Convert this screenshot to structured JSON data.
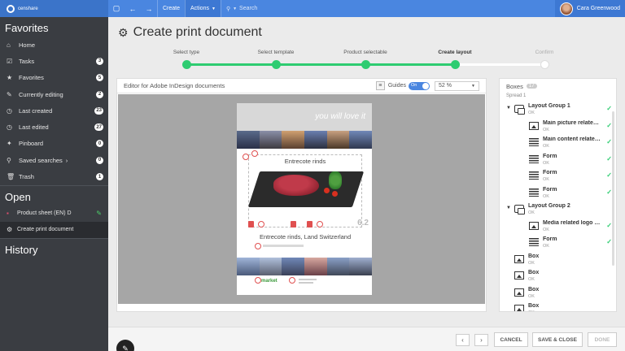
{
  "topbar": {
    "logo_text": "censhare",
    "create_label": "Create",
    "actions_label": "Actions",
    "search_placeholder": "Search",
    "user_name": "Cara Greenwood"
  },
  "sidebar": {
    "favorites_heading": "Favorites",
    "items": [
      {
        "label": "Home",
        "count": "",
        "icon": "home-icon"
      },
      {
        "label": "Tasks",
        "count": "3",
        "icon": "tasks-icon"
      },
      {
        "label": "Favorites",
        "count": "5",
        "icon": "star-icon"
      },
      {
        "label": "Currently editing",
        "count": "2",
        "icon": "pencil-icon"
      },
      {
        "label": "Last created",
        "count": "23",
        "icon": "clock-icon"
      },
      {
        "label": "Last edited",
        "count": "27",
        "icon": "clock-icon"
      },
      {
        "label": "Pinboard",
        "count": "0",
        "icon": "pin-icon"
      },
      {
        "label": "Saved searches",
        "count": "0",
        "icon": "search-icon"
      },
      {
        "label": "Trash",
        "count": "1",
        "icon": "trash-icon"
      }
    ],
    "open_heading": "Open",
    "open_items": [
      {
        "label": "Product sheet (EN) D"
      },
      {
        "label": "Create print document"
      }
    ],
    "history_heading": "History"
  },
  "main": {
    "title": "Create print document",
    "steps": [
      {
        "label": "Select type"
      },
      {
        "label": "Select template"
      },
      {
        "label": "Product selectable"
      },
      {
        "label": "Create layout"
      },
      {
        "label": "Confirm"
      }
    ]
  },
  "editor": {
    "title": "Editor for Adobe InDesign documents",
    "guides_label": "Guides",
    "toggle_label": "On",
    "zoom_value": "52 %",
    "doc": {
      "tagline": "you will love it",
      "dish_title": "Entrecote rinds",
      "price": "6.2",
      "subtitle": "Entrecote rinds, Land Switzerland",
      "market_label": "market"
    }
  },
  "boxes": {
    "title": "Boxes",
    "count": "17",
    "spread_label": "Spread 1",
    "items": [
      {
        "name": "Layout Group 1",
        "status": "OK"
      },
      {
        "name": "Main picture related i...",
        "status": "OK"
      },
      {
        "name": "Main content related t...",
        "status": "OK"
      },
      {
        "name": "Form",
        "status": "OK"
      },
      {
        "name": "Form",
        "status": "OK"
      },
      {
        "name": "Form",
        "status": "OK"
      },
      {
        "name": "Layout Group 2",
        "status": "OK"
      },
      {
        "name": "Media related logo im...",
        "status": "OK"
      },
      {
        "name": "Form",
        "status": "OK"
      },
      {
        "name": "Box",
        "status": "OK"
      },
      {
        "name": "Box",
        "status": "OK"
      },
      {
        "name": "Box",
        "status": "OK"
      },
      {
        "name": "Box",
        "status": "OK"
      }
    ]
  },
  "footer": {
    "cancel_label": "CANCEL",
    "save_close_label": "SAVE & CLOSE",
    "done_label": "DONE"
  },
  "colors": {
    "accent": "#4a86e0",
    "sidebar_bg": "#3a3d42",
    "success": "#2ecc71"
  }
}
